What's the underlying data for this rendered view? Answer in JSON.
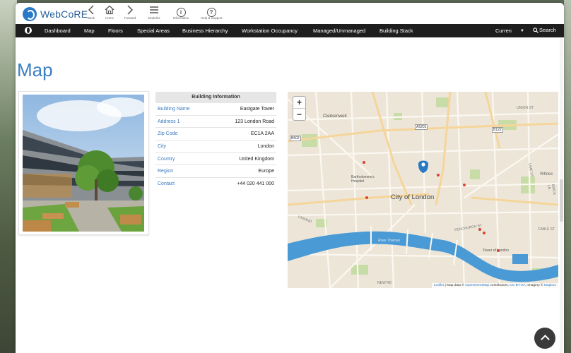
{
  "app": {
    "name": "WebCoRE"
  },
  "toolbar": [
    {
      "icon": "back-icon",
      "label": "Back"
    },
    {
      "icon": "home-icon",
      "label": "Home"
    },
    {
      "icon": "forward-icon",
      "label": "Forward"
    },
    {
      "icon": "modules-icon",
      "label": "Modules"
    },
    {
      "icon": "information-icon",
      "label": "Information"
    },
    {
      "icon": "help-icon",
      "label": "Help & Support"
    }
  ],
  "nav": {
    "items": [
      "Dashboard",
      "Map",
      "Floors",
      "Special Areas",
      "Business Hierarchy",
      "Workstation Occupancy",
      "Managed/Unmanaged",
      "Building Stack"
    ],
    "currency": "Curren",
    "search": "Search"
  },
  "page": {
    "title": "Map"
  },
  "building": {
    "heading": "Building Information",
    "rows": [
      {
        "key": "Building Name",
        "value": "Eastgate Tower"
      },
      {
        "key": "Address 1",
        "value": "123 London Road"
      },
      {
        "key": "Zip Code",
        "value": "EC1A 2AA"
      },
      {
        "key": "City",
        "value": "London"
      },
      {
        "key": "Country",
        "value": "United Kingdom"
      },
      {
        "key": "Region",
        "value": "Europe"
      },
      {
        "key": "Contact",
        "value": "+44 020 441 000"
      }
    ]
  },
  "map": {
    "zoom_in": "+",
    "zoom_out": "−",
    "center_label": "City of London",
    "places": [
      "Clerkenwell",
      "Bartholomew's Hospital",
      "Tower of London",
      "River Thames",
      "Whitec",
      "STRAND",
      "FENCHURCH ST",
      "LIME ST",
      "GOSSET ST",
      "UNION ST",
      "CABLE ST",
      "NEW RD",
      "BRICK LN"
    ],
    "roads": [
      "A5201",
      "B502",
      "B122",
      "A1"
    ],
    "attribution": {
      "leaflet": "Leaflet",
      "middle": " | Map data © ",
      "osm": "OpenStreetMap",
      "contrib": " contributors, ",
      "cc": "CC-BY-SA",
      "imagery": ", Imagery © ",
      "mapbox": "Mapbox"
    }
  },
  "colors": {
    "accent": "#3c7fc2",
    "navbar": "#1e1e1e",
    "river": "#4a9ad6",
    "marker": "#2a79c6"
  }
}
